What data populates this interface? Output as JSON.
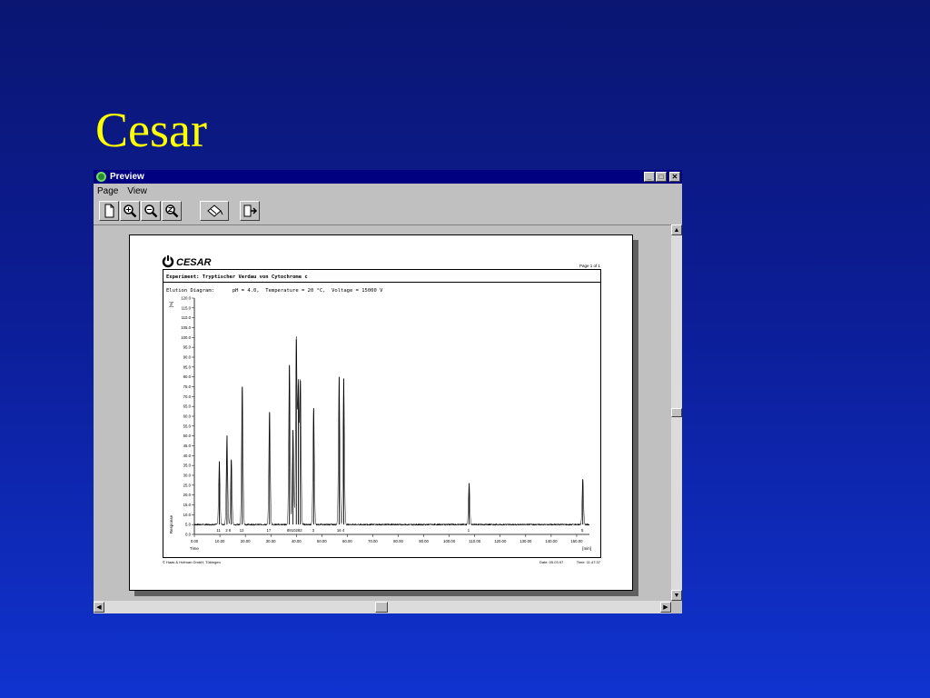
{
  "slide": {
    "title": "Cesar"
  },
  "window": {
    "title": "Preview",
    "menu": [
      "Page",
      "View"
    ],
    "toolbar_icons": [
      "new-page-icon",
      "zoom-in-icon",
      "zoom-out-icon",
      "zoom-fit-icon",
      "print-icon",
      "exit-icon"
    ],
    "controls": {
      "minimize": "_",
      "maximize": "□",
      "close": "✕"
    }
  },
  "report": {
    "brand": "CESAR",
    "page_label": "Page 1 of 1",
    "experiment": "Experiment: Tryptischer Verdau von Cytochrome c",
    "conditions": "Elution Diagram:      pH = 4.0,  Temperature = 20 °C,  Voltage = 15000 V",
    "unit_label": "[%]",
    "response_label": "Response",
    "time_label": "Time",
    "time_unit": "[min]",
    "footer_left": "© Haas & Hofman GmbH, Tübingen",
    "footer_date": "Date: 05.03.97",
    "footer_time": "Time: 11:47:37"
  },
  "chart_data": {
    "type": "line",
    "xlim": [
      0,
      155
    ],
    "ylim": [
      0,
      120
    ],
    "x_ticks": [
      0,
      10,
      20,
      30,
      40,
      50,
      60,
      70,
      80,
      90,
      100,
      110,
      120,
      130,
      140,
      150
    ],
    "y_ticks": [
      0,
      5,
      10,
      15,
      20,
      25,
      30,
      35,
      40,
      45,
      50,
      55,
      60,
      65,
      70,
      75,
      80,
      85,
      90,
      95,
      100,
      105,
      110,
      115,
      120
    ],
    "baseline": 5,
    "peaks": [
      {
        "x": 9.8,
        "height": 37
      },
      {
        "x": 12.8,
        "height": 50
      },
      {
        "x": 14.5,
        "height": 38
      },
      {
        "x": 18.8,
        "height": 75
      },
      {
        "x": 29.5,
        "height": 62
      },
      {
        "x": 37.3,
        "height": 86
      },
      {
        "x": 38.7,
        "height": 53
      },
      {
        "x": 40.0,
        "height": 99
      },
      {
        "x": 40.8,
        "height": 76
      },
      {
        "x": 41.6,
        "height": 78
      },
      {
        "x": 46.8,
        "height": 64
      },
      {
        "x": 56.8,
        "height": 80
      },
      {
        "x": 58.6,
        "height": 79
      },
      {
        "x": 107.8,
        "height": 26
      },
      {
        "x": 152.4,
        "height": 28
      }
    ],
    "peak_labels": [
      {
        "x": 9.5,
        "text": "11"
      },
      {
        "x": 13.3,
        "text": "2 6"
      },
      {
        "x": 18.6,
        "text": "12"
      },
      {
        "x": 29.2,
        "text": "17"
      },
      {
        "x": 39.3,
        "text": "8910282"
      },
      {
        "x": 46.6,
        "text": "3"
      },
      {
        "x": 57.4,
        "text": "16 4"
      },
      {
        "x": 107.6,
        "text": "1"
      },
      {
        "x": 152.2,
        "text": "5"
      }
    ]
  }
}
